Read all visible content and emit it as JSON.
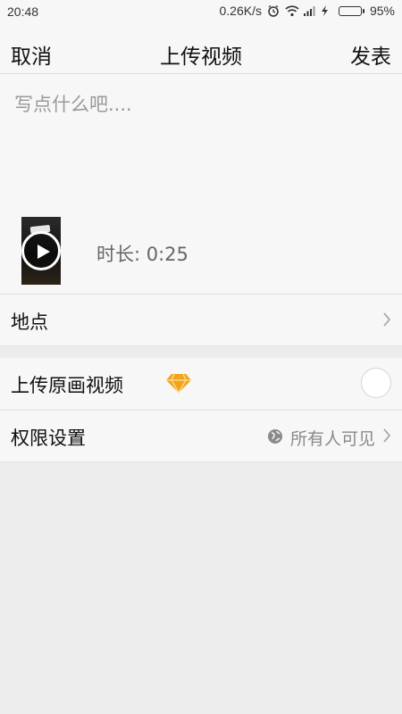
{
  "status_bar": {
    "time": "20:48",
    "network_speed": "0.26K/s",
    "battery_percent": "95%",
    "battery_level": 0.95,
    "icons": [
      "alarm-icon",
      "wifi-icon",
      "signal-icon",
      "charging-icon",
      "battery-icon"
    ]
  },
  "header": {
    "cancel_label": "取消",
    "title": "上传视频",
    "publish_label": "发表"
  },
  "composer": {
    "placeholder": "写点什么吧....",
    "duration_label": "时长: 0:25"
  },
  "settings": {
    "location_label": "地点",
    "original_label": "上传原画视频",
    "original_enabled": false,
    "permission_label": "权限设置",
    "permission_value": "所有人可见"
  },
  "colors": {
    "accent_diamond": "#f2a31a",
    "battery_green": "#3bbf2a",
    "background": "#ededed",
    "panel": "#f7f7f7"
  }
}
